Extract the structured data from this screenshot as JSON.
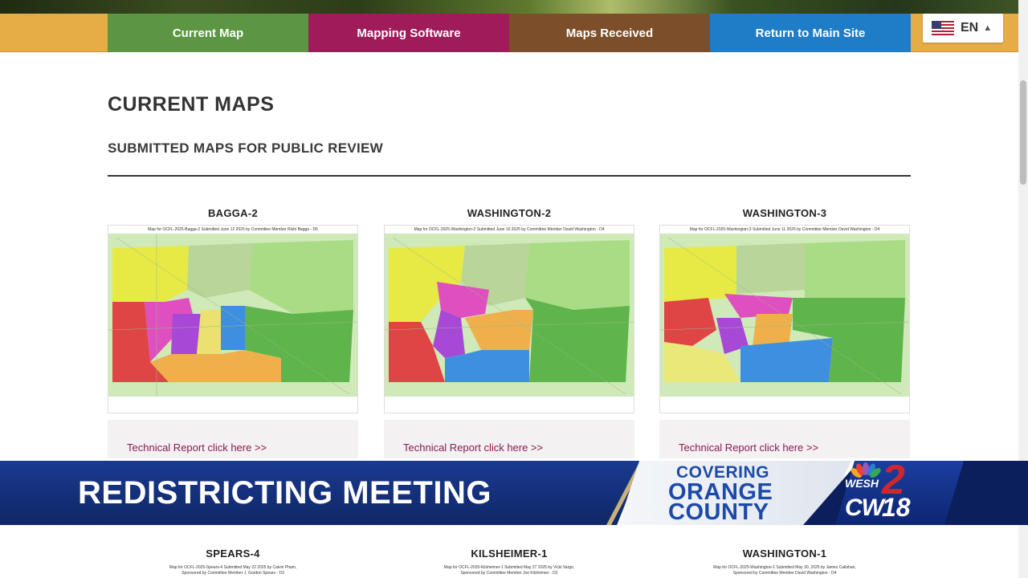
{
  "nav": {
    "items": [
      {
        "label": "Current Map"
      },
      {
        "label": "Mapping Software"
      },
      {
        "label": "Maps Received"
      },
      {
        "label": "Return to Main Site"
      }
    ],
    "language": "EN"
  },
  "page": {
    "title": "CURRENT MAPS",
    "subtitle": "SUBMITTED MAPS FOR PUBLIC REVIEW"
  },
  "maps": [
    {
      "title": "BAGGA-2",
      "caption": "Map for OCFL-2025-Bagga-2 Submitted June 12 2025 by Committee Member Rishi Bagga - D5",
      "link": "Technical Report click here >>"
    },
    {
      "title": "WASHINGTON-2",
      "caption": "Map for OCFL-2025-Washington-2 Submitted June 10 2025 by Committee Member David Washington - D4",
      "link": "Technical Report click here >>"
    },
    {
      "title": "WASHINGTON-3",
      "caption": "Map for OCFL-2025-Washington-3 Submitted June 11 2025 by Committee Member David Washington - D4",
      "link": "Technical Report click here >>"
    }
  ],
  "maps_row2": [
    {
      "title": "SPEARS-4",
      "caption1": "Map for OCFL-2025-Spears-4 Submitted May 22 2025 by Calvin Pham,",
      "caption2": "Sponsored by Committee Member J. Gordon Spears - D3"
    },
    {
      "title": "KILSHEIMER-1",
      "caption1": "Map for OCFL-2025-Kilsheimer-1 Submitted May 27 2025 by Vicki Vargo,",
      "caption2": "Sponsored by Committee Member Joe Kilsheimer - D2"
    },
    {
      "title": "WASHINGTON-1",
      "caption1": "Map for OCFL-2025-Washington-1 Submitted May 30, 2025 by James Callahan,",
      "caption2": "Sponsored by Committee Member David Washington - D4"
    }
  ],
  "broadcast": {
    "headline": "REDISTRICTING MEETING",
    "cover_line1": "COVERING",
    "cover_line2": "ORANGE",
    "cover_line3": "COUNTY",
    "station1": "WESH",
    "station1_num": "2",
    "station2": "CW",
    "station2_num": "18"
  },
  "colors": {
    "nav_current": "#5c9643",
    "nav_software": "#a01b5a",
    "nav_received": "#7c4f2a",
    "nav_return": "#1f7cc6",
    "nav_bar": "#e6ac45",
    "link": "#8a1a4f",
    "lower_third_blue": "#14307c"
  },
  "icons": {
    "language_flag": "us-flag-icon",
    "language_chevron": "chevron-up-icon",
    "station_logo": "nbc-peacock-icon"
  }
}
